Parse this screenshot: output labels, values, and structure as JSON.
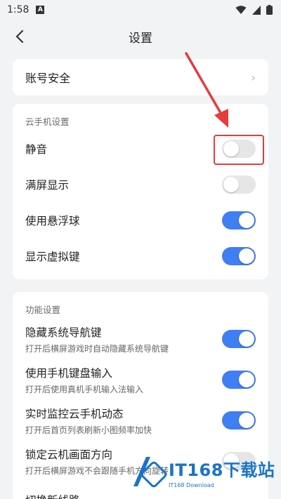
{
  "status_bar": {
    "time": "1:58",
    "app_badge": "A"
  },
  "header": {
    "title": "设置"
  },
  "account": {
    "label": "账号安全",
    "chevron": "›"
  },
  "cloud_section": {
    "title": "云手机设置",
    "items": [
      {
        "label": "静音",
        "on": false
      },
      {
        "label": "满屏显示",
        "on": false
      },
      {
        "label": "使用悬浮球",
        "on": true
      },
      {
        "label": "显示虚拟键",
        "on": true
      }
    ]
  },
  "function_section": {
    "title": "功能设置",
    "items": [
      {
        "label": "隐藏系统导航键",
        "sub": "打开后横屏游戏时自动隐藏系统导航键",
        "on": true
      },
      {
        "label": "使用手机键盘输入",
        "sub": "打开后使用真机手机输入法输入",
        "on": true
      },
      {
        "label": "实时监控云手机动态",
        "sub": "打开后首页列表刷新小图频率加快",
        "on": true
      },
      {
        "label": "锁定云机画面方向",
        "sub": "打开后横屏游戏不会跟随手机方向旋转",
        "on": false
      },
      {
        "label": "切换新线路"
      }
    ]
  },
  "watermark": {
    "main": "IT168下载站",
    "sub": "IT168 Download"
  },
  "colors": {
    "accent": "#3f7ef3",
    "annotation": "#e53c3c"
  }
}
